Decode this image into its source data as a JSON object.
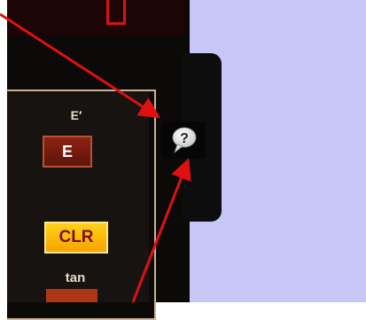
{
  "calculator": {
    "label_e_prime": "E′",
    "button_e": "E",
    "button_clr": "CLR",
    "label_tan": "tan"
  },
  "help": {
    "icon": "help-speech-bubble-icon",
    "glyph": "?"
  },
  "colors": {
    "page_background": "#c8c8f8",
    "calculator_body": "#0b0a09",
    "panel_border": "#cdb294",
    "button_e": "#8c2214",
    "button_clr": "#ffc20a",
    "arrow": "#e01010"
  }
}
